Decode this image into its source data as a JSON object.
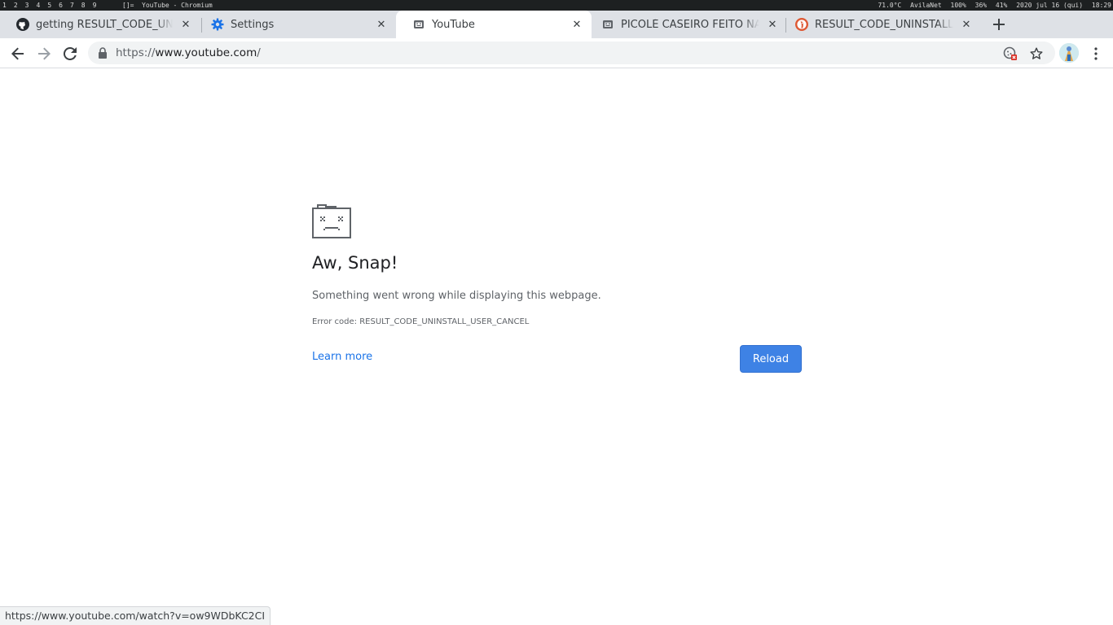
{
  "system_bar": {
    "workspaces": [
      "1",
      "2",
      "3",
      "4",
      "5",
      "6",
      "7",
      "8",
      "9"
    ],
    "layout": "[]=",
    "window_title": "YouTube - Chromium",
    "temperature": "71.0°C",
    "network": "AvilaNet",
    "battery": "100%",
    "brightness": "36%",
    "volume": "41%",
    "date": "2020 jul 16 (qui)",
    "time": "18:29"
  },
  "tabs": [
    {
      "title": "getting RESULT_CODE_UNINSTALL_USER_CANCEL",
      "icon": "github-icon",
      "close": "✕"
    },
    {
      "title": "Settings",
      "icon": "gear-icon",
      "close": "✕"
    },
    {
      "title": "YouTube",
      "icon": "sad-tab-icon",
      "close": "✕",
      "active": true
    },
    {
      "title": "PICOLÉ CASEIRO FEITO NA CASA",
      "icon": "sad-tab-icon",
      "close": "✕"
    },
    {
      "title": "RESULT_CODE_UNINSTALL_USER_CANCEL",
      "icon": "duckduckgo-icon",
      "close": "✕"
    }
  ],
  "new_tab_label": "+",
  "toolbar": {
    "url_scheme": "https://",
    "url_host": "www.youtube.com",
    "url_path": "/"
  },
  "page": {
    "headline": "Aw, Snap!",
    "message": "Something went wrong while displaying this webpage.",
    "error_code": "Error code: RESULT_CODE_UNINSTALL_USER_CANCEL",
    "learn_more": "Learn more",
    "reload": "Reload"
  },
  "status_bubble": "https://www.youtube.com/watch?v=ow9WDbKC2CI",
  "colors": {
    "accent": "#1a73e8",
    "reload_button": "#3e82e5",
    "tabstrip": "#dee1e6",
    "omnibox": "#f1f3f4"
  }
}
